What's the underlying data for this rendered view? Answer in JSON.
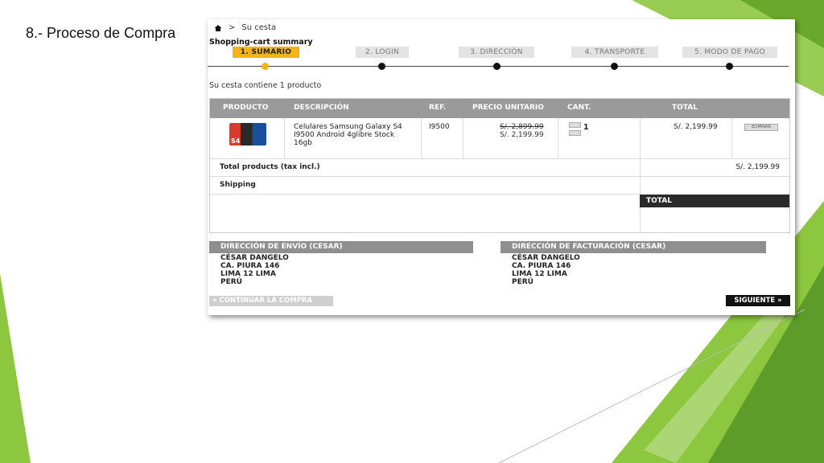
{
  "slide": {
    "title": "8.- Proceso de Compra"
  },
  "colors": {
    "accent_green": "#8dc63f",
    "step_active": "#f2b417",
    "header_gray": "#9a9a9a"
  },
  "breadcrumb": {
    "home_icon": "home-icon",
    "separator": ">",
    "current": "Su cesta"
  },
  "summary": {
    "title": "Shopping-cart summary",
    "count_text": "Su cesta contiene 1 producto"
  },
  "steps": [
    {
      "label": "1. SUMARIO",
      "active": true
    },
    {
      "label": "2. LOGIN",
      "active": false
    },
    {
      "label": "3. DIRECCIÓN",
      "active": false
    },
    {
      "label": "4. TRANSPORTE",
      "active": false
    },
    {
      "label": "5. MODO DE PAGO",
      "active": false
    }
  ],
  "table": {
    "headers": {
      "product": "PRODUCTO",
      "description": "DESCRIPCIÓN",
      "ref": "REF.",
      "unit_price": "PRECIO UNITARIO",
      "qty": "CANT.",
      "total": "TOTAL"
    },
    "rows": [
      {
        "image_badge": "S4",
        "description": "Celulares Samsung Galaxy S4 I9500 Android 4glibre Stock 16gb",
        "ref": "I9500",
        "old_price": "S/. 2,899.99",
        "price": "S/. 2,199.99",
        "qty": "1",
        "total": "S/. 2,199.99",
        "remove_label": "ELIMINAR"
      }
    ],
    "total_products_label": "Total products (tax incl.)",
    "total_products_value": "S/. 2,199.99",
    "shipping_label": "Shipping",
    "total_label": "TOTAL"
  },
  "shipping_address": {
    "title": "DIRECCIÓN DE ENVÍO (CESAR)",
    "lines": [
      "CÉSAR DANGELO",
      "CA. PIURA 146",
      "LIMA 12 LIMA",
      "PERÚ"
    ]
  },
  "billing_address": {
    "title": "DIRECCIÓN DE FACTURACIÓN (CESAR)",
    "lines": [
      "CÉSAR DANGELO",
      "CA. PIURA 146",
      "LIMA 12 LIMA",
      "PERÚ"
    ]
  },
  "buttons": {
    "continue": "« CONTINUAR LA COMPRA",
    "next": "SIGUIENTE »"
  }
}
